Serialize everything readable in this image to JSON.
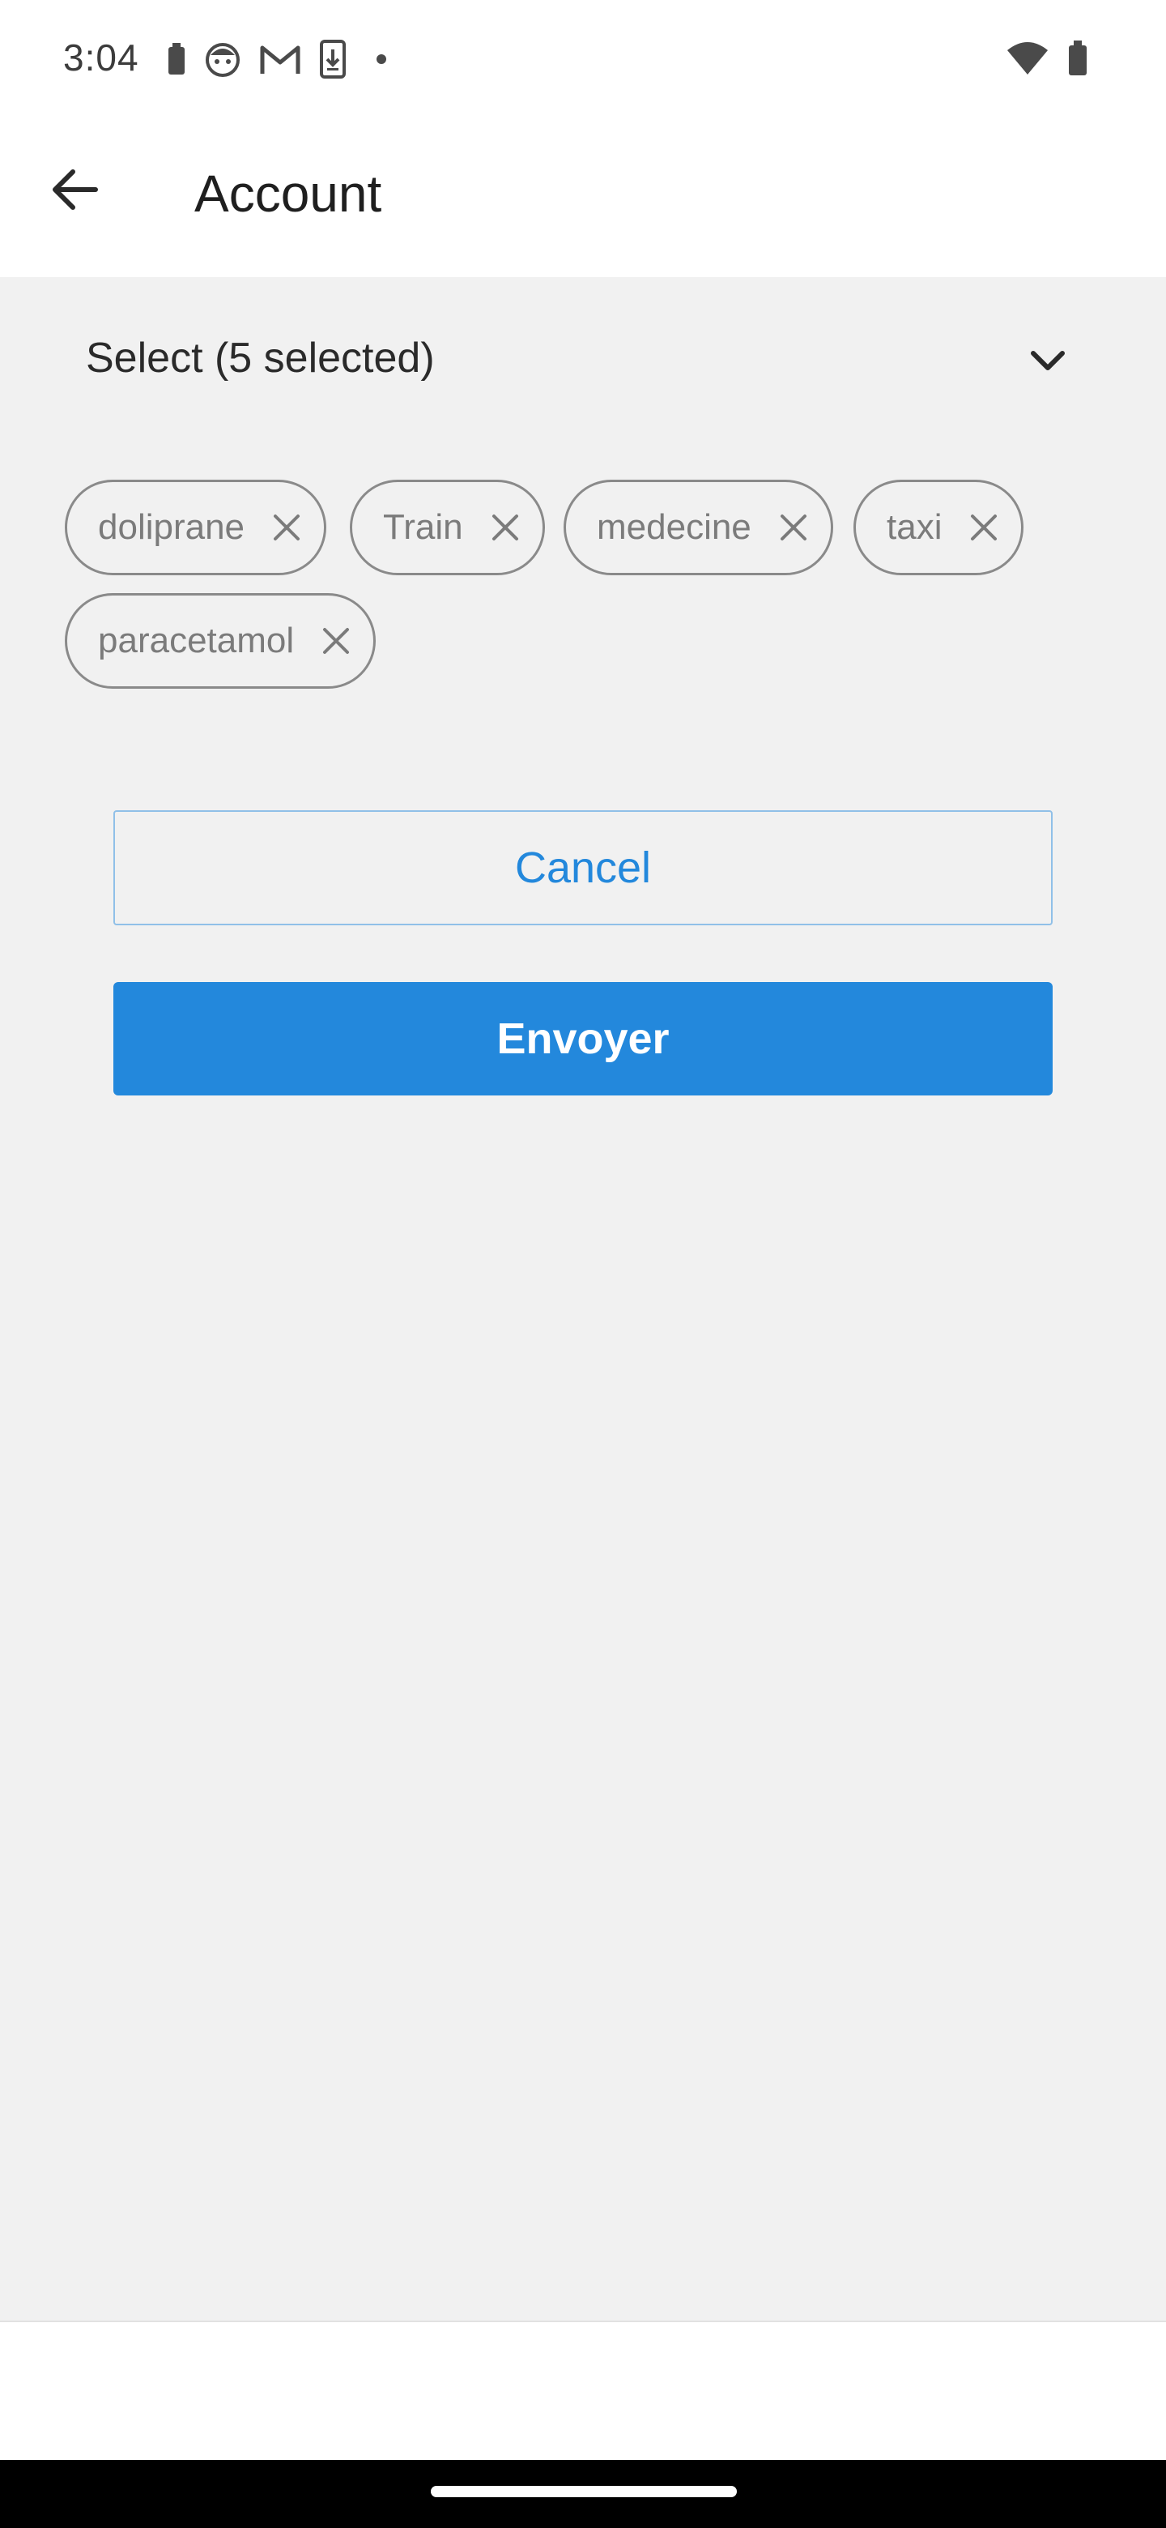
{
  "status_bar": {
    "time": "3:04",
    "left_icons": [
      "battery-saver-icon",
      "face-icon",
      "gmail-icon",
      "phone-download-icon",
      "dot-icon"
    ],
    "right_icons": [
      "wifi-icon",
      "battery-icon"
    ]
  },
  "app_bar": {
    "title": "Account",
    "back_icon": "arrow-left-icon"
  },
  "select": {
    "label": "Select (5 selected)",
    "chevron_icon": "chevron-down-icon"
  },
  "chips": [
    {
      "label": "doliprane"
    },
    {
      "label": "Train"
    },
    {
      "label": "medecine"
    },
    {
      "label": "taxi"
    },
    {
      "label": "paracetamol"
    }
  ],
  "actions": {
    "cancel_label": "Cancel",
    "send_label": "Envoyer"
  },
  "colors": {
    "accent": "#2388dc",
    "background": "#f1f1f1",
    "chip_border": "#8a8a8a",
    "chip_text": "#7b7b7b"
  }
}
